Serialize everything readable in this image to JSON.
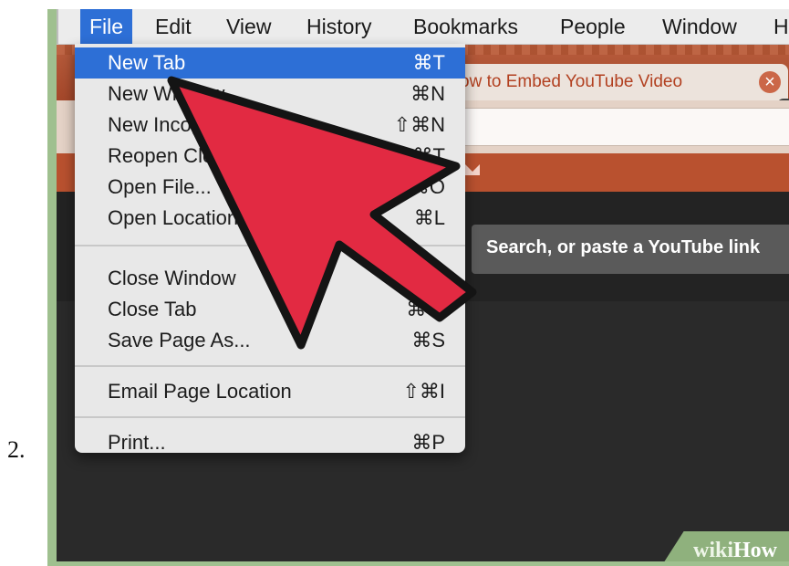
{
  "step_number": "2.",
  "menubar": {
    "items": [
      "File",
      "Edit",
      "View",
      "History",
      "Bookmarks",
      "People",
      "Window",
      "H"
    ],
    "active": "File"
  },
  "browser": {
    "tab_title": "ow to Embed YouTube Video",
    "tab_close": "×",
    "search_placeholder": "Search, or paste a YouTube link"
  },
  "file_menu": {
    "items": [
      {
        "label": "New Tab",
        "shortcut": "⌘T",
        "highlighted": true
      },
      {
        "label": "New Window",
        "shortcut": "⌘N"
      },
      {
        "label": "New Incognito Window",
        "shortcut": "⇧⌘N"
      },
      {
        "label": "Reopen Closed Tab",
        "shortcut": "⇧⌘T"
      },
      {
        "label": "Open File...",
        "shortcut": "⌘O"
      },
      {
        "label": "Open Location...",
        "shortcut": "⌘L"
      },
      {
        "label": "Close Window",
        "shortcut": "⇧⌘W"
      },
      {
        "label": "Close Tab",
        "shortcut": "⌘W"
      },
      {
        "label": "Save Page As...",
        "shortcut": "⌘S"
      },
      {
        "label": "Email Page Location",
        "shortcut": "⇧⌘I"
      },
      {
        "label": "Print...",
        "shortcut": "⌘P"
      }
    ]
  },
  "watermark": {
    "prefix": "wiki",
    "suffix": "How"
  },
  "colors": {
    "menu_highlight": "#2d6fd6",
    "arrow": "#e22a42",
    "frame": "#9fc08f"
  },
  "icons": {
    "pointer": "arrow-pointer-icon"
  }
}
